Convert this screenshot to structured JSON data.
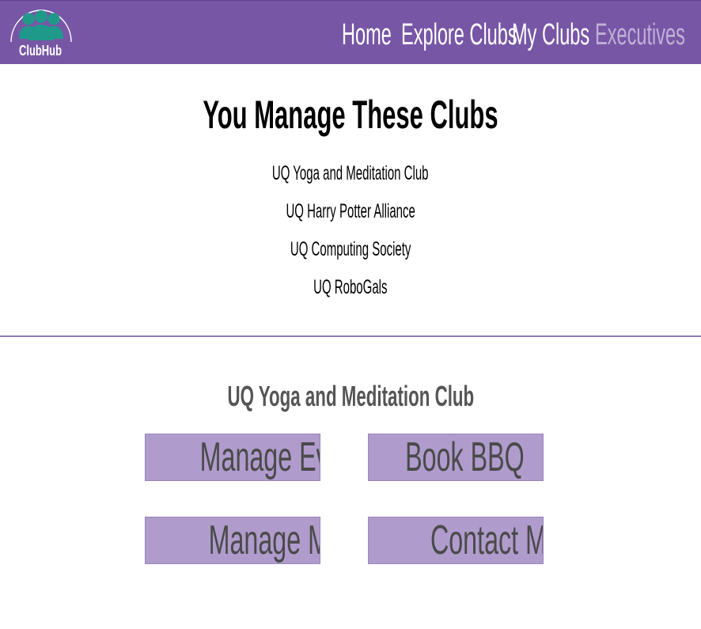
{
  "header": {
    "logo_text": "ClubHub",
    "nav": [
      {
        "label": "Home",
        "active": false
      },
      {
        "label": "Explore Clubs",
        "active": false
      },
      {
        "label": "My Clubs",
        "active": false
      },
      {
        "label": "Executives",
        "active": true
      }
    ]
  },
  "main": {
    "title": "You Manage These Clubs",
    "clubs": [
      "UQ Yoga and Meditation Club",
      "UQ Harry Potter Alliance",
      "UQ Computing Society",
      "UQ RoboGals"
    ]
  },
  "selected_club": {
    "name": "UQ Yoga and Meditation Club",
    "actions": {
      "manage_events": "Manage Events",
      "book_bbq": "Book BBQ",
      "manage_members": "Manage Members",
      "contact_members": "Contact Members"
    }
  },
  "colors": {
    "header_bg": "#7756a6",
    "active_nav": "#bfb1d6",
    "button_bg": "#af9ccc",
    "logo_people": "#1f9a8a",
    "divider": "#8e78b4"
  },
  "icons": {
    "logo": "people-group-icon"
  }
}
